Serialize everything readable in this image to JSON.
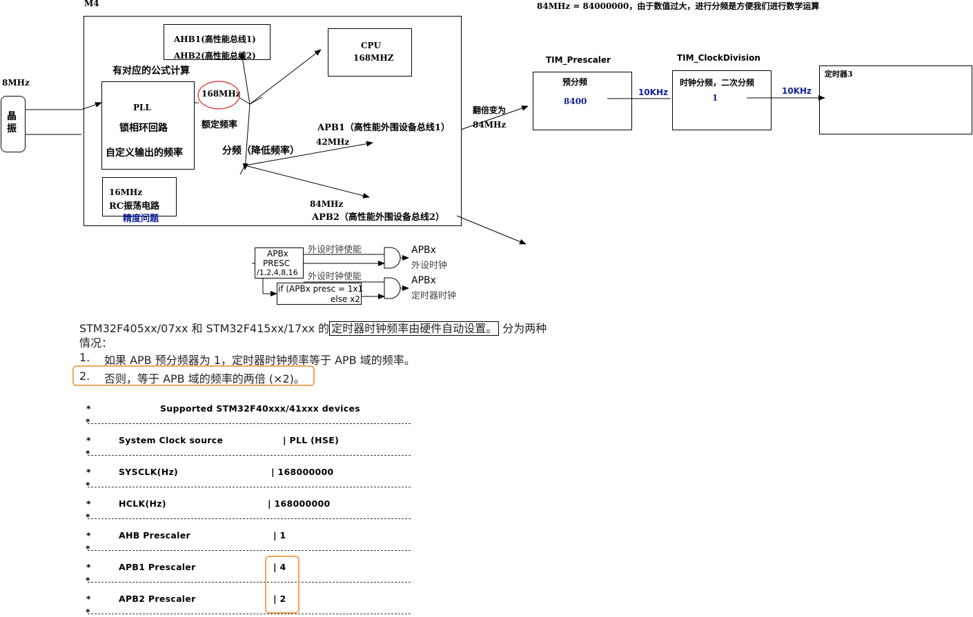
{
  "top_note": "84MHz = 84000000，由于数值过大，进行分频是方便我们进行数学运算",
  "m4_label": "M4",
  "left": {
    "osc_freq": "8MHz",
    "crystal_label_1": "晶",
    "crystal_label_2": "振"
  },
  "core": {
    "ahb_line1": "AHB1(高性能总线1)",
    "ahb_line2": "AHB2(高性能总线2)",
    "cpu_line1": "CPU",
    "cpu_line2": "168MHZ",
    "formula_label": "有对应的公式计算",
    "pll_title": "PLL",
    "pll_line2": "锁相环回路",
    "pll_line3": "自定义输出的频率",
    "pll_out": "168MHz",
    "rated_freq": "额定频率",
    "divide_label": "分频（降低频率）",
    "apb1_label": "APB1（高性能外围设备总线1）",
    "apb1_freq": "42MHz",
    "apb2_freq": "84MHz",
    "apb2_label": "APB2（高性能外围设备总线2）",
    "rc_freq": "16MHz",
    "rc_label": "RC振荡电路",
    "rc_note": "精度问题"
  },
  "timer_chain": {
    "doubled_label": "翻倍变为",
    "doubled_freq": "84MHz",
    "prescaler_title": "TIM_Prescaler",
    "prescaler_box_title": "预分频",
    "prescaler_value": "8400",
    "out_freq_1": "10KHz",
    "clockdiv_title": "TIM_ClockDivision",
    "clockdiv_box_title": "时钟分频，二次分频",
    "clockdiv_value": "1",
    "out_freq_2": "10KHz",
    "timer_label": "定时器3"
  },
  "presc_diagram": {
    "presc_line1": "APBx",
    "presc_line2": "PRESC",
    "presc_line3": "/1,2,4,8,16",
    "enable_1": "外设时钟使能",
    "enable_2": "外设时钟使能",
    "cond_line1": "if (APBx presc = 1x1",
    "cond_line2": "else x2",
    "out1_line1": "APBx",
    "out1_line2": "外设时钟",
    "out2_line1": "APBx",
    "out2_line2": "定时器时钟"
  },
  "doc": {
    "para_pre": "STM32F405xx/07xx 和 STM32F415xx/17xx 的",
    "para_box": "定时器时钟频率由硬件自动设置。",
    "para_post": "分为两种",
    "para_line2": "情况：",
    "item1_num": "1.",
    "item1_text": "如果 APB 预分频器为 1，定时器时钟频率等于 APB 域的频率。",
    "item2_num": "2.",
    "item2_text": "否则，等于 APB 域的频率的两倍 (×2)。"
  },
  "table": {
    "star": "*",
    "divider_star": "*",
    "title": "Supported STM32F40xxx/41xxx devices",
    "rows": [
      {
        "label": "System Clock source",
        "value": "| PLL (HSE)"
      },
      {
        "label": "SYSCLK(Hz)",
        "value": "| 168000000"
      },
      {
        "label": "HCLK(Hz)",
        "value": "| 168000000"
      },
      {
        "label": "AHB Prescaler",
        "value": "| 1"
      },
      {
        "label": "APB1 Prescaler",
        "value": "| 4"
      },
      {
        "label": "APB2 Prescaler",
        "value": "| 2"
      }
    ]
  },
  "colors": {
    "blue_text": "#0b1f9c",
    "highlight_orange": "#f0a45b",
    "circle_red": "#e02020"
  }
}
